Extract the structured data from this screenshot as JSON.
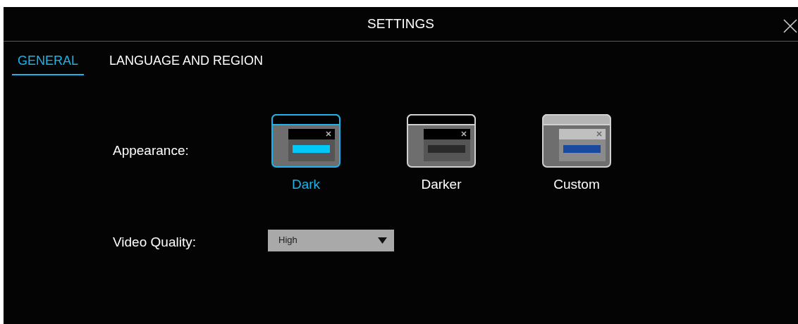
{
  "window": {
    "title": "SETTINGS"
  },
  "tabs": [
    {
      "label": "GENERAL",
      "selected": true
    },
    {
      "label": "LANGUAGE AND REGION",
      "selected": false
    }
  ],
  "appearance": {
    "label": "Appearance:",
    "themes": [
      {
        "label": "Dark",
        "kind": "dark",
        "selected": true
      },
      {
        "label": "Darker",
        "kind": "darker",
        "selected": false
      },
      {
        "label": "Custom",
        "kind": "custom",
        "selected": false
      }
    ]
  },
  "video_quality": {
    "label": "Video Quality:",
    "value": "High"
  }
}
